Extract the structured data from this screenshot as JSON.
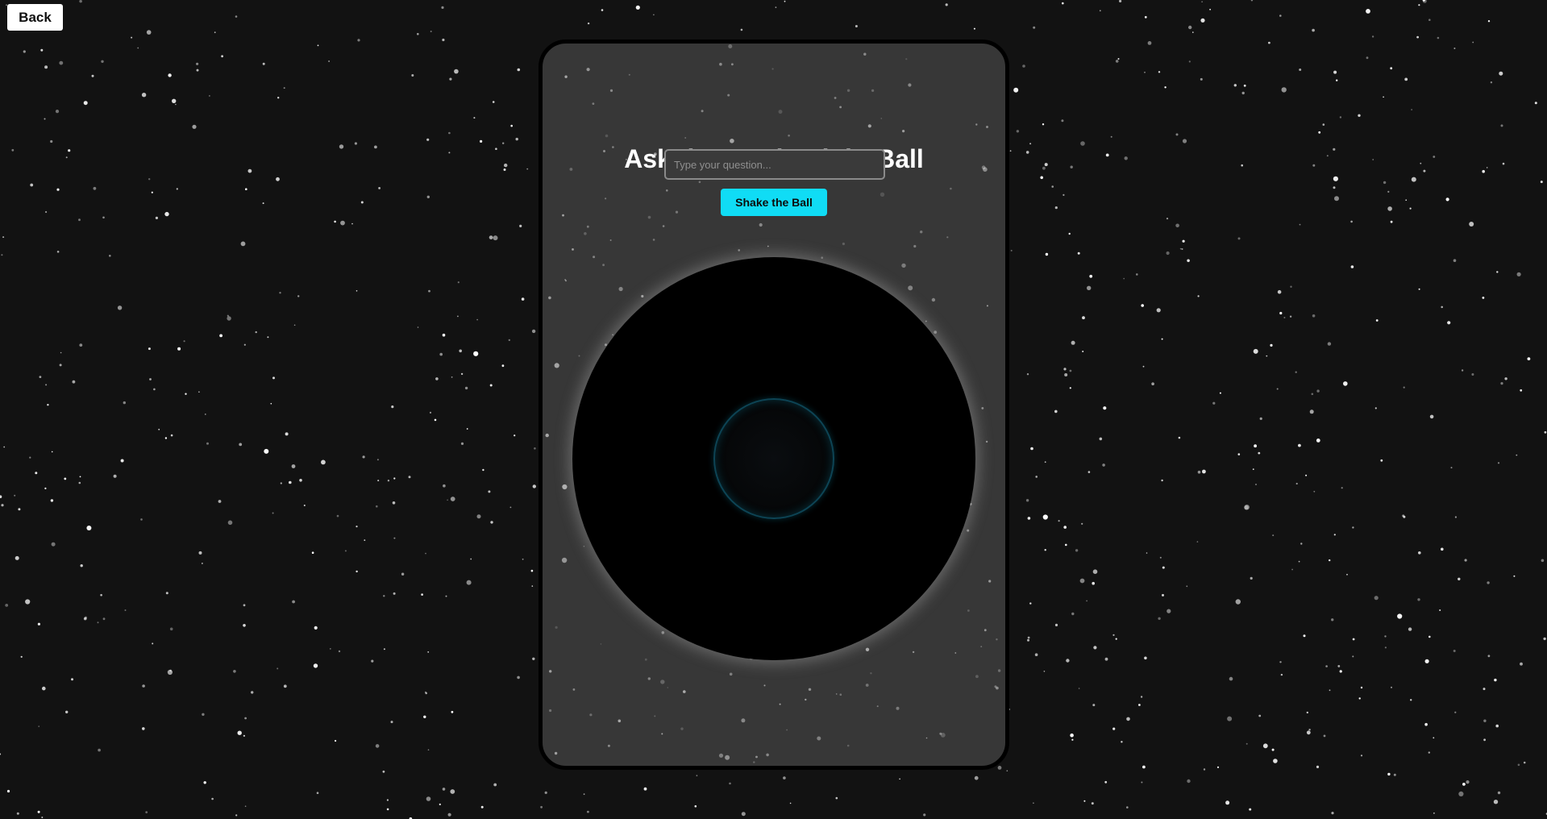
{
  "nav": {
    "back_label": "Back"
  },
  "card": {
    "title": "Ask the Magic Eight Ball",
    "question_placeholder": "Type your question...",
    "question_value": "",
    "shake_label": "Shake the Ball",
    "answer_text": ""
  },
  "colors": {
    "page_background": "#121212",
    "card_background": "#373737",
    "card_border": "#000000",
    "accent": "#10dcf5",
    "ball": "#000000",
    "text": "#ffffff"
  },
  "icons": {
    "background": "starfield",
    "ball": "magic-eight-ball"
  }
}
